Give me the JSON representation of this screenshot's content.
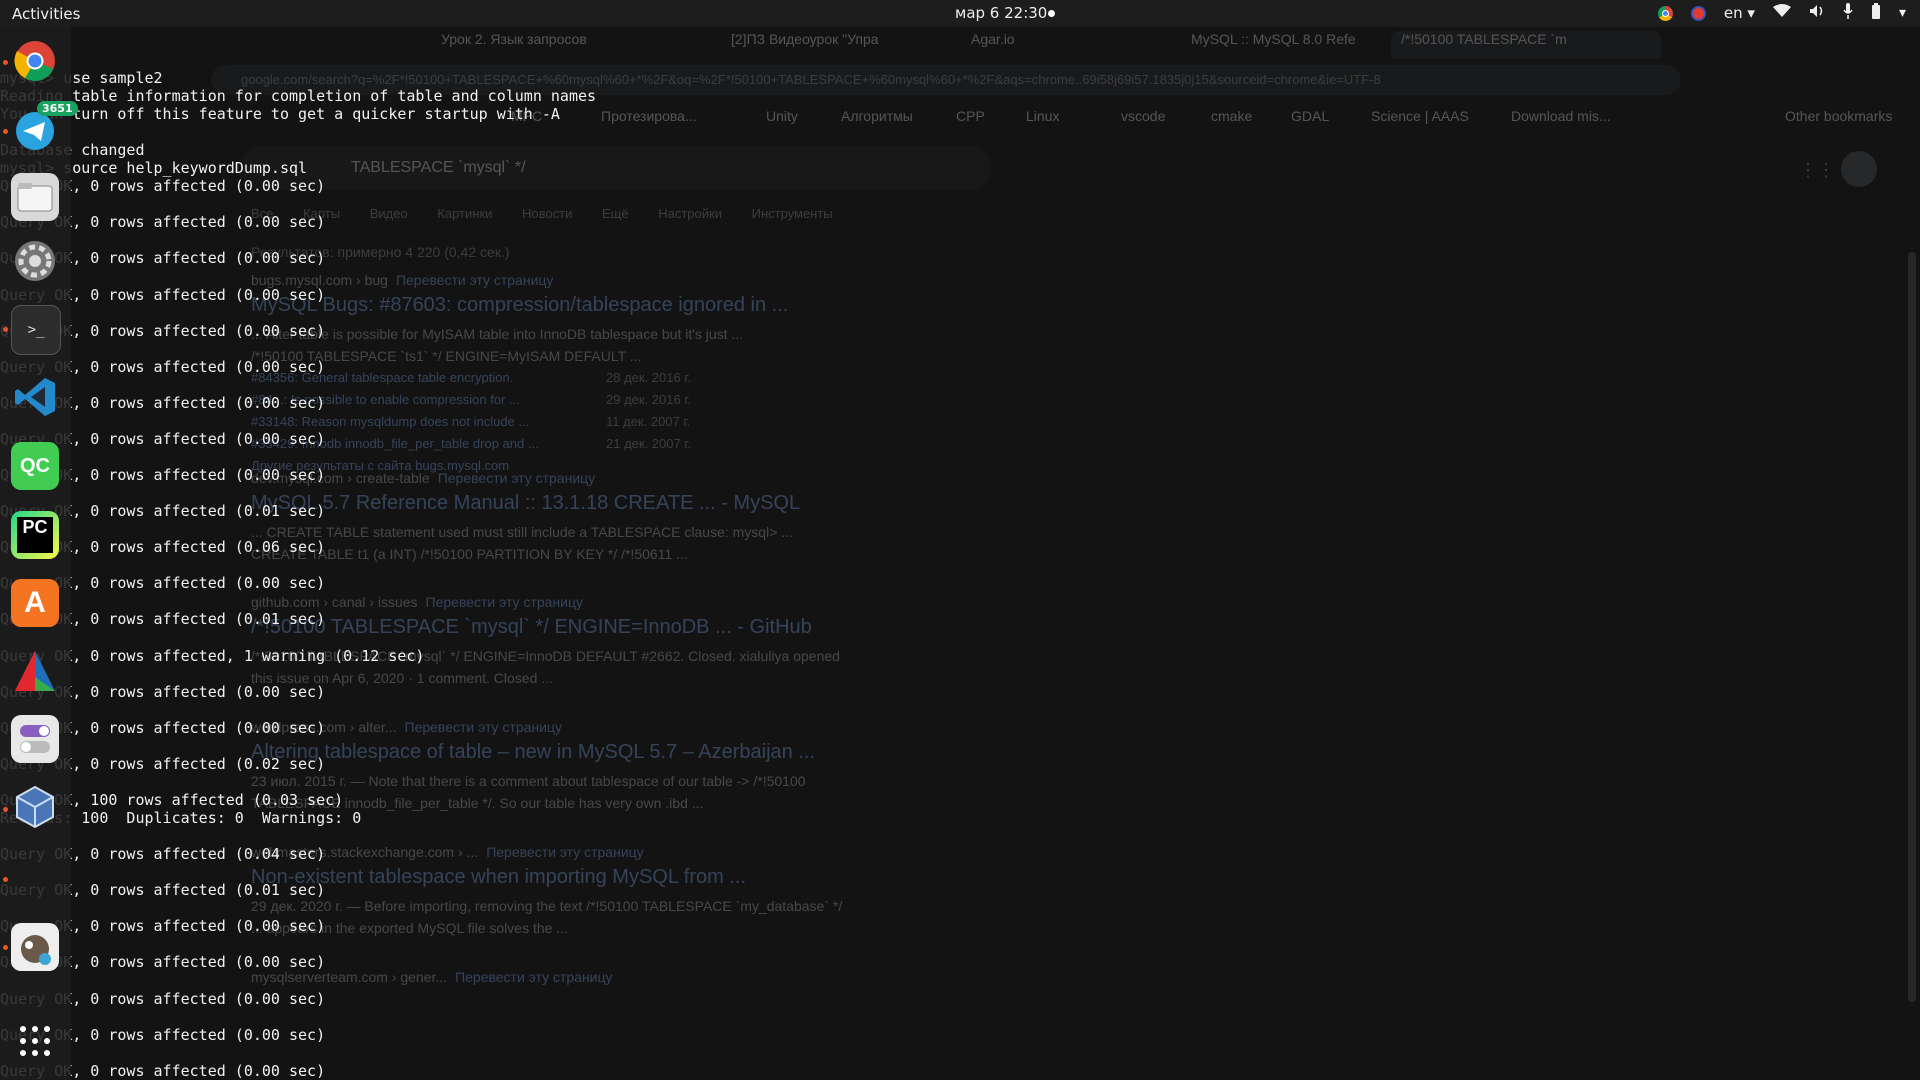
{
  "topbar": {
    "activities": "Activities",
    "clock": "мар 6  22:30",
    "language": "en ▾"
  },
  "dock": {
    "items": [
      {
        "name": "chrome-icon"
      },
      {
        "name": "telegram-icon",
        "badge": "3651"
      },
      {
        "name": "files-icon"
      },
      {
        "name": "settings-icon"
      },
      {
        "name": "terminal-icon",
        "glyph": ">_"
      },
      {
        "name": "vscode-icon"
      },
      {
        "name": "qtcreator-icon",
        "glyph": "QC"
      },
      {
        "name": "pycharm-icon",
        "glyph": "PC"
      },
      {
        "name": "software-center-icon",
        "glyph": "A"
      },
      {
        "name": "cmake-icon"
      },
      {
        "name": "tweaks-icon"
      },
      {
        "name": "virtualbox-icon"
      },
      {
        "name": "gimp-icon"
      },
      {
        "name": "show-apps-icon"
      }
    ]
  },
  "browser": {
    "tabs": [
      {
        "label": "Урок 2. Язык запросов"
      },
      {
        "label": "[2]ПЗ Видеоурок \"Упра"
      },
      {
        "label": "Agar.io"
      },
      {
        "label": "MySQL :: MySQL 8.0 Refe"
      },
      {
        "label": "/*!50100 TABLESPACE `m"
      }
    ],
    "url": "google.com/search?q=%2F*!50100+TABLESPACE+%60mysql%60+*%2F&oq=%2F*!50100+TABLESPACE+%60mysql%60+*%2F&aqs=chrome..69i58j69i57.1835j0j15&sourceid=chrome&ie=UTF-8",
    "bookmarks": [
      "MPC",
      "Протезирова...",
      "Unity",
      "Алгоритмы",
      "CPP",
      "Linux",
      "vscode",
      "cmake",
      "GDAL",
      "Science | AAAS",
      "Download mis...",
      "Other bookmarks"
    ],
    "search_query": "TABLESPACE `mysql` */",
    "search_tabs": [
      "Все",
      "Карты",
      "Видео",
      "Картинки",
      "Новости",
      "Ещё",
      "Настройки",
      "Инструменты"
    ],
    "result_count": "Результатов: примерно 4 220 (0,42 сек.)",
    "translate": "Перевести эту страницу",
    "results": [
      {
        "crumb": "bugs.mysql.com › bug",
        "title": "MySQL Bugs: #87603: compression/tablespace ignored in ...",
        "snippet1": "... Alter table is possible for MyISAM table into InnoDB tablespace but it's just ...",
        "snippet2": "/*!50100 TABLESPACE `ts1` */ ENGINE=MyISAM DEFAULT ...",
        "subs": [
          {
            "text": "#84356: General tablespace table encryption.",
            "date": "28 дек. 2016 г."
          },
          {
            "text": "#84...: Is possible to enable compression for ...",
            "date": "29 дек. 2016 г."
          },
          {
            "text": "#33148: Reason mysqldump does not include ...",
            "date": "11 дек. 2007 г."
          },
          {
            "text": "#33429: Innodb innodb_file_per_table drop and ...",
            "date": "21 дек. 2007 г."
          }
        ],
        "more": "Другие результаты с сайта bugs.mysql.com"
      },
      {
        "crumb": "dev.mysql.com › create-table",
        "title": "MySQL 5.7 Reference Manual :: 13.1.18 CREATE ... - MySQL",
        "snippet1": "... CREATE TABLE statement used must still include a TABLESPACE clause: mysql> ...",
        "snippet2": "CREATE TABLE t1 (a INT) /*!50100 PARTITION BY KEY */ /*!50611 ..."
      },
      {
        "crumb": "github.com › canal › issues",
        "title": "/*!50100 TABLESPACE `mysql` */ ENGINE=InnoDB ... - GitHub",
        "snippet1": "/*!50100 TABLESPACE `mysql` */ ENGINE=InnoDB DEFAULT #2662. Closed. xialuliya opened",
        "snippet2": "this issue on Apr 6, 2020 · 1 comment. Closed ..."
      },
      {
        "crumb": "wordpress.com › alter...",
        "title": "Altering tablespace of table – new in MySQL 5.7 – Azerbaijan ...",
        "snippet1": "23 июл. 2015 г. — Note that there is a comment about tablespace of our table -> /*!50100",
        "snippet2": "TABLESPACE innodb_file_per_table */. So our table has very own .ibd ..."
      },
      {
        "crumb": "webmasters.stackexchange.com › ...",
        "title": "Non-existent tablespace when importing MySQL from ...",
        "snippet1": "29 дек. 2020 г. — Before importing, removing the text /*!50100 TABLESPACE `my_database` */",
        "snippet2": "... appears in the exported MySQL file solves the ..."
      },
      {
        "crumb": "mysqlserverteam.com › gener...",
        "title": "",
        "snippet1": "",
        "snippet2": ""
      }
    ]
  },
  "terminal": {
    "lines": [
      "Reading table information for completion of table and column names",
      "You can turn off this feature to get a quicker startup with -A",
      "",
      "Database changed",
      "mysql> source help_keywordDump.sql",
      "Query OK, 0 rows affected (0.00 sec)",
      "",
      "Query OK, 0 rows affected (0.00 sec)",
      "",
      "Query OK, 0 rows affected (0.00 sec)",
      "",
      "Query OK, 0 rows affected (0.00 sec)",
      "",
      "Query OK, 0 rows affected (0.00 sec)",
      "",
      "Query OK, 0 rows affected (0.00 sec)",
      "",
      "Query OK, 0 rows affected (0.00 sec)",
      "",
      "Query OK, 0 rows affected (0.00 sec)",
      "",
      "Query OK, 0 rows affected (0.00 sec)",
      "",
      "Query OK, 0 rows affected (0.01 sec)",
      "",
      "Query OK, 0 rows affected (0.06 sec)",
      "",
      "Query OK, 0 rows affected (0.00 sec)",
      "",
      "Query OK, 0 rows affected (0.01 sec)",
      "",
      "Query OK, 0 rows affected, 1 warning (0.12 sec)",
      "",
      "Query OK, 0 rows affected (0.00 sec)",
      "",
      "Query OK, 0 rows affected (0.00 sec)",
      "",
      "Query OK, 0 rows affected (0.02 sec)",
      "",
      "Query OK, 100 rows affected (0.03 sec)",
      "Records: 100  Duplicates: 0  Warnings: 0",
      "",
      "Query OK, 0 rows affected (0.04 sec)",
      "",
      "Query OK, 0 rows affected (0.01 sec)",
      "",
      "Query OK, 0 rows affected (0.00 sec)",
      "",
      "Query OK, 0 rows affected (0.00 sec)",
      "",
      "Query OK, 0 rows affected (0.00 sec)",
      "",
      "Query OK, 0 rows affected (0.00 sec)",
      "",
      "Query OK, 0 rows affected (0.00 sec)"
    ],
    "top_lines": [
      "mysql> use sample2"
    ]
  }
}
